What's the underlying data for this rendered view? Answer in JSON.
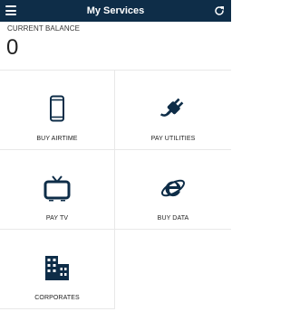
{
  "header": {
    "title": "My Services",
    "menu_icon": "hamburger-menu-icon",
    "refresh_icon": "refresh-icon",
    "background": "#0e2d48"
  },
  "balance": {
    "label": "CURRENT BALANCE",
    "value": "0"
  },
  "services": [
    {
      "label": "BUY AIRTIME",
      "icon": "mobile-phone-icon"
    },
    {
      "label": "PAY UTILITIES",
      "icon": "power-plug-icon"
    },
    {
      "label": "PAY TV",
      "icon": "tv-icon"
    },
    {
      "label": "BUY DATA",
      "icon": "internet-explorer-icon"
    },
    {
      "label": "CORPORATES",
      "icon": "buildings-icon"
    }
  ],
  "colors": {
    "icon": "#0e2d48",
    "divider": "#e8e8e8"
  }
}
